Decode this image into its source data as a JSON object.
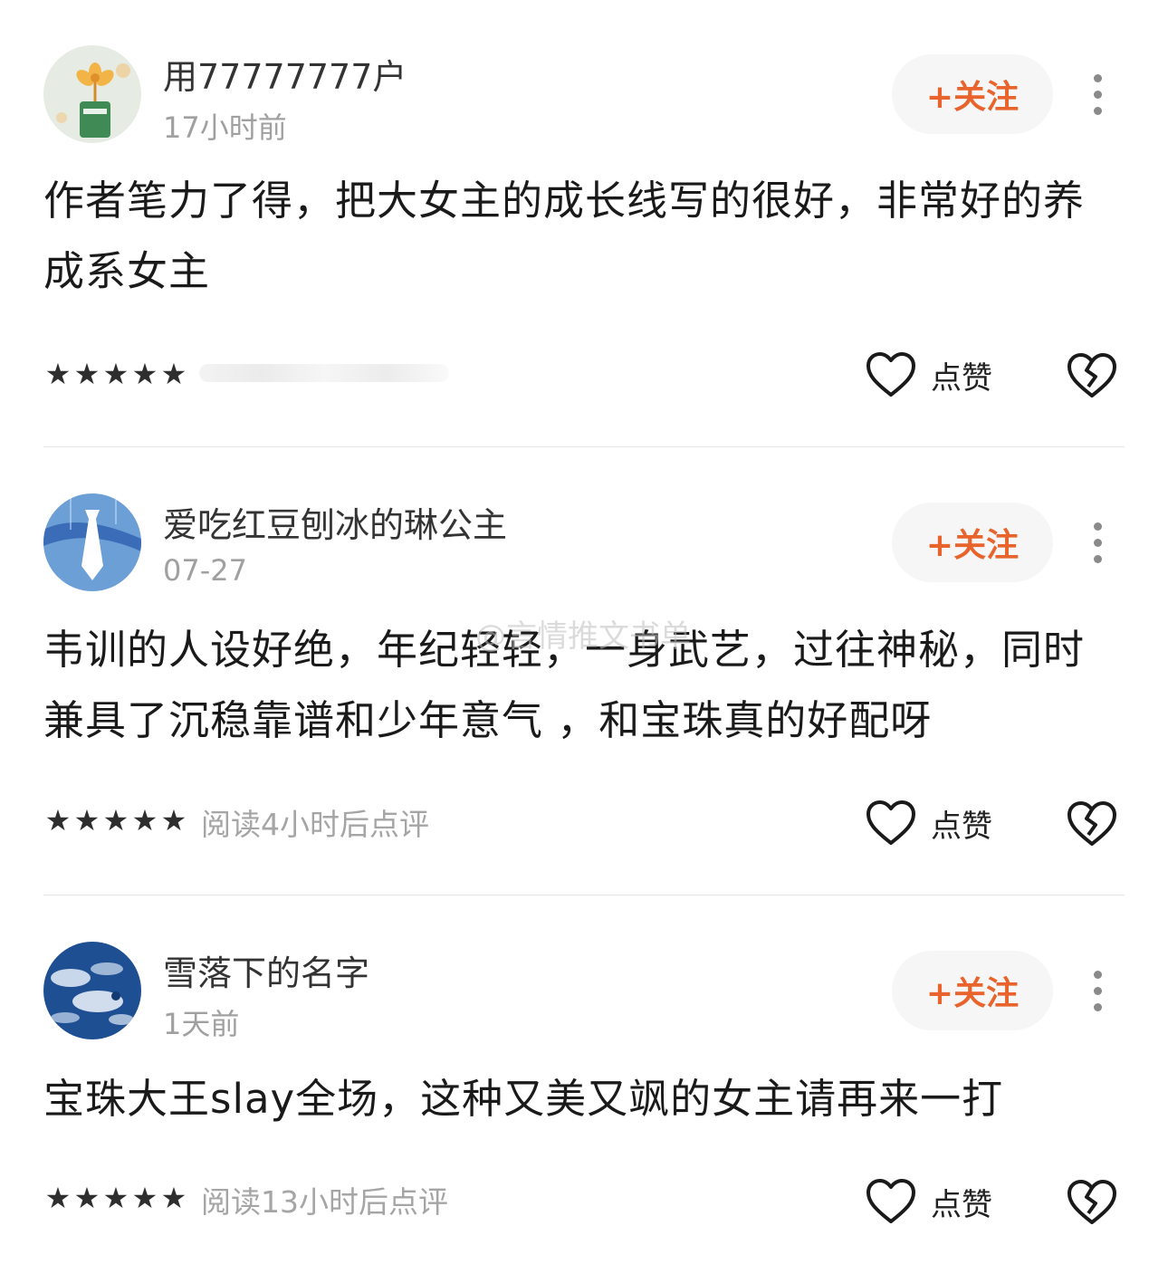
{
  "comments": [
    {
      "username": "用77777777户",
      "time": "17小时前",
      "follow_label": "+关注",
      "text": "作者笔力了得，把大女主的成长线写的很好，非常好的养成系女主",
      "stars": "★★★★★",
      "read_note": "",
      "like_label": "点赞",
      "avatar_icon": "flower-cup-avatar"
    },
    {
      "username": "爱吃红豆刨冰的琳公主",
      "time": "07-27",
      "follow_label": "+关注",
      "text": "韦训的人设好绝，年纪轻轻，一身武艺，过往神秘，同时兼具了沉稳靠谱和少年意气 ，和宝珠真的好配呀",
      "stars": "★★★★★",
      "read_note": "阅读4小时后点评",
      "like_label": "点赞",
      "avatar_icon": "tie-avatar"
    },
    {
      "username": "雪落下的名字",
      "time": "1天前",
      "follow_label": "+关注",
      "text": "宝珠大王slay全场，这种又美又飒的女主请再来一打",
      "stars": "★★★★★",
      "read_note": "阅读13小时后点评",
      "like_label": "点赞",
      "avatar_icon": "earth-clouds-avatar"
    }
  ],
  "watermark": "@言情推文书单",
  "colors": {
    "accent": "#e8642c",
    "follow_bg": "#f6f6f6",
    "muted_text": "#a0a0a0"
  }
}
